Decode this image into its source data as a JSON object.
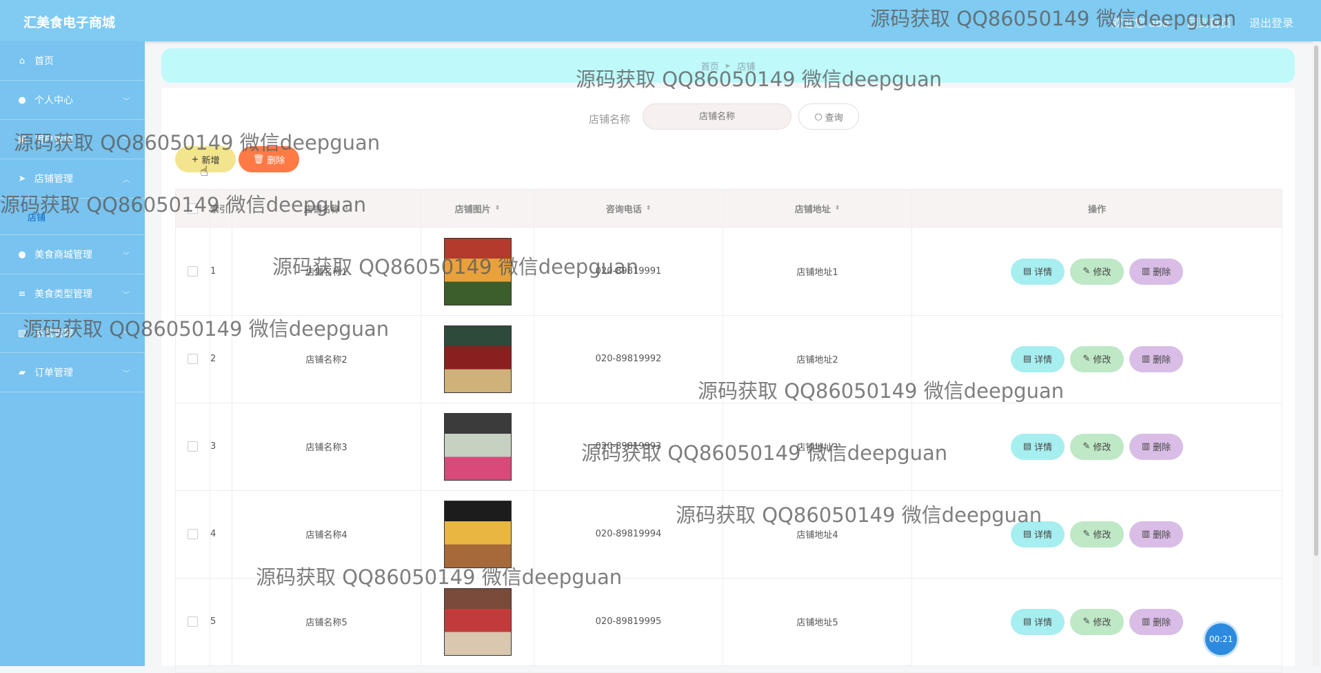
{
  "app": {
    "title": "汇美食电子商城"
  },
  "header": {
    "links": [
      "欢迎您 abo",
      "回到首页",
      "退出登录"
    ]
  },
  "sidebar": {
    "items": [
      {
        "label": "首页",
        "icon": "home-icon",
        "glyph": "⌂",
        "chevron": false
      },
      {
        "label": "个人中心",
        "icon": "user-icon",
        "glyph": "●",
        "chevron": true
      },
      {
        "label": "用户管理",
        "icon": "user-manage-icon",
        "glyph": "▣",
        "chevron": true
      },
      {
        "label": "店铺管理",
        "icon": "send-icon",
        "glyph": "➤",
        "chevron": true,
        "expanded": true,
        "children": [
          "店铺"
        ]
      },
      {
        "label": "美食商城管理",
        "icon": "shop-icon",
        "glyph": "●",
        "chevron": true
      },
      {
        "label": "美食类型管理",
        "icon": "list-icon",
        "glyph": "≡",
        "chevron": true
      },
      {
        "label": "系统管理",
        "icon": "system-icon",
        "glyph": "▨",
        "chevron": true
      },
      {
        "label": "订单管理",
        "icon": "order-icon",
        "glyph": "▰",
        "chevron": true
      }
    ]
  },
  "breadcrumb": [
    "首页",
    "店铺"
  ],
  "search": {
    "label": "店铺名称",
    "placeholder": "店铺名称",
    "button": "查询"
  },
  "toolbar": {
    "add_label": "新增",
    "delete_label": "删除"
  },
  "table": {
    "columns": [
      "索引",
      "店铺名称",
      "店铺图片",
      "咨询电话",
      "店铺地址",
      "操作"
    ],
    "rows": [
      {
        "index": "1",
        "name": "店铺名称1",
        "phone": "020-89819991",
        "address": "店铺地址1",
        "img_colors": [
          "#b33a2c",
          "#e8a13b",
          "#3c5d2c"
        ]
      },
      {
        "index": "2",
        "name": "店铺名称2",
        "phone": "020-89819992",
        "address": "店铺地址2",
        "img_colors": [
          "#2e4a3a",
          "#8a1f1f",
          "#cfb27a"
        ]
      },
      {
        "index": "3",
        "name": "店铺名称3",
        "phone": "020-89819993",
        "address": "店铺地址3",
        "img_colors": [
          "#3b3b3b",
          "#c6d1c2",
          "#d84a7a"
        ]
      },
      {
        "index": "4",
        "name": "店铺名称4",
        "phone": "020-89819994",
        "address": "店铺地址4",
        "img_colors": [
          "#1c1c1c",
          "#e9b640",
          "#a66a3a"
        ]
      },
      {
        "index": "5",
        "name": "店铺名称5",
        "phone": "020-89819995",
        "address": "店铺地址5",
        "img_colors": [
          "#7a4a3a",
          "#c23b3b",
          "#d9c7b0"
        ]
      }
    ],
    "actions": {
      "detail": "详情",
      "edit": "修改",
      "delete": "删除"
    }
  },
  "watermark": {
    "text": "源码获取 QQ86050149 微信deepguan"
  },
  "timer": "00:21",
  "colors": {
    "header": "#7fcbf2",
    "sidebar": "#78c3ef",
    "breadcrumb": "#bff9fa",
    "add": "#f3e58e",
    "delete": "#ff7a45"
  }
}
